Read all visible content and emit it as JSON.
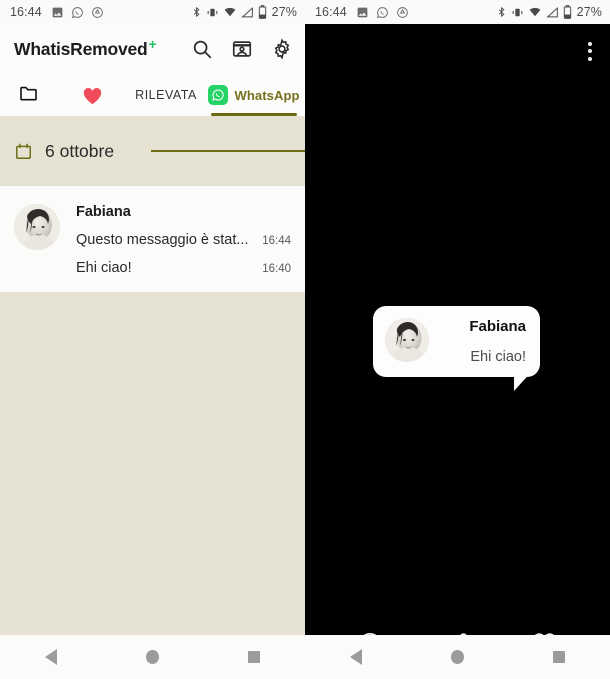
{
  "status_bar": {
    "clock": "16:44",
    "battery": "27%",
    "left_icons": [
      "photo-icon",
      "whatsapp-icon",
      "drive-icon"
    ],
    "right_icons": [
      "bluetooth-icon",
      "vibrate-icon",
      "wifi-icon",
      "signal-icon",
      "battery-icon"
    ]
  },
  "left_panel": {
    "app_title": "WhatisRemoved",
    "app_title_plus": "+",
    "actions": [
      {
        "name": "search-icon",
        "label": "Search"
      },
      {
        "name": "gallery-icon",
        "label": "Gallery"
      },
      {
        "name": "settings-gear-icon",
        "label": "Settings"
      }
    ],
    "tabs": [
      {
        "id": "folder",
        "label": "",
        "icon": "folder-icon",
        "active": false
      },
      {
        "id": "favorite",
        "label": "",
        "icon": "heart-icon",
        "active": false
      },
      {
        "id": "detected",
        "label": "RILEVATA",
        "icon": "",
        "active": false
      },
      {
        "id": "whatsapp",
        "label": "WhatsApp",
        "icon": "whatsapp-badge-icon",
        "active": true
      }
    ],
    "date_header": {
      "icon": "calendar-icon",
      "date": "6 ottobre"
    },
    "messages": [
      {
        "sender": "Fabiana",
        "avatar": "contact-photo",
        "lines": [
          {
            "text": "Questo messaggio è stat...",
            "time": "16:44"
          },
          {
            "text": "Ehi ciao!",
            "time": "16:40"
          }
        ]
      }
    ]
  },
  "right_panel": {
    "overflow_menu": "kebab-menu-icon",
    "bubble": {
      "sender": "Fabiana",
      "text": "Ehi ciao!",
      "avatar": "contact-photo"
    },
    "actions": [
      {
        "id": "info",
        "icon": "info-circle-icon"
      },
      {
        "id": "share",
        "icon": "share-icon"
      },
      {
        "id": "favorite",
        "icon": "heart-outline-icon"
      }
    ]
  },
  "nav_bar": {
    "buttons": [
      {
        "id": "back",
        "icon": "back-triangle-icon"
      },
      {
        "id": "home",
        "icon": "home-circle-icon"
      },
      {
        "id": "recents",
        "icon": "recents-square-icon"
      }
    ]
  },
  "colors": {
    "beige_bg": "#e5e2d2",
    "card_bg": "#fbfbf9",
    "accent_olive": "#6e6a14",
    "whatsapp_green": "#25D366",
    "plus_green": "#22c06a",
    "heart_red": "#ef4b5a",
    "dark_bg": "#000000"
  }
}
